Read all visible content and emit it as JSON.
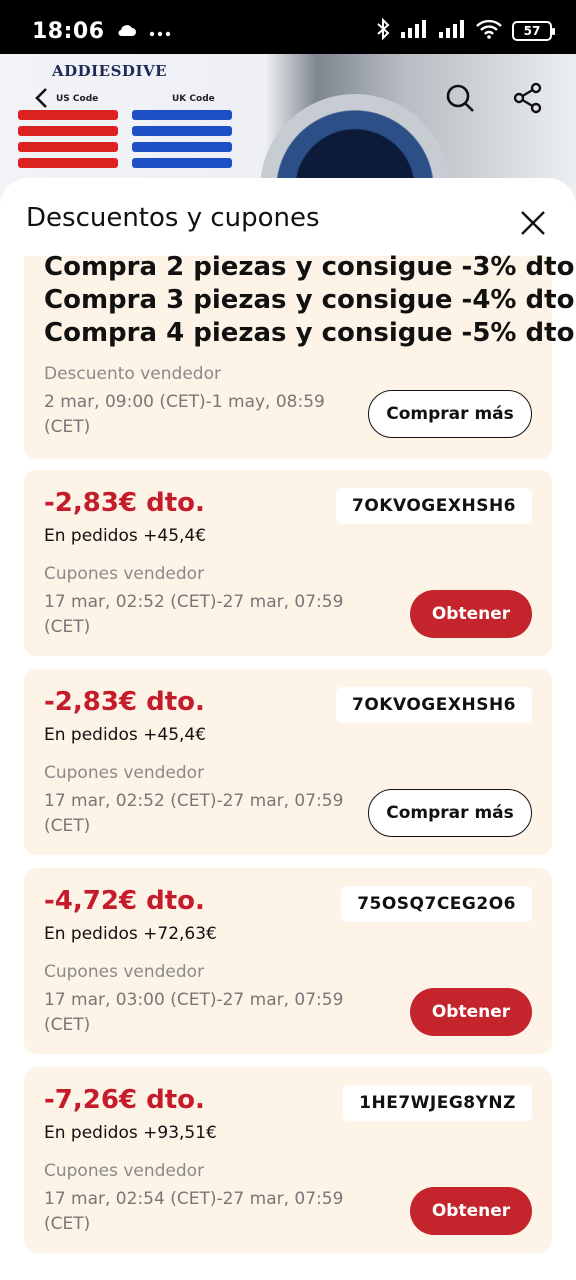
{
  "status_bar": {
    "time": "18:06",
    "battery": "57"
  },
  "hero": {
    "brand": "ADDIESDIVE",
    "us_code_label": "US Code",
    "uk_code_label": "UK Code"
  },
  "sheet": {
    "title": "Descuentos y cupones"
  },
  "promo_card": {
    "lines": [
      "Compra 2 piezas y consigue -3% dto.",
      "Compra 3 piezas y consigue -4% dto.",
      "Compra 4 piezas y consigue -5% dto."
    ],
    "label": "Descuento vendedor",
    "date": "2 mar, 09:00 (CET)-1 may, 08:59 (CET)",
    "button": "Comprar más"
  },
  "coupons": [
    {
      "discount": "-2,83€ dto.",
      "condition": "En pedidos +45,4€",
      "code": "7OKVOGEXHSH6",
      "label": "Cupones vendedor",
      "date": "17 mar, 02:52 (CET)-27 mar, 07:59 (CET)",
      "button": "Obtener"
    },
    {
      "discount": "-2,83€ dto.",
      "condition": "En pedidos +45,4€",
      "code": "7OKVOGEXHSH6",
      "label": "Cupones vendedor",
      "date": "17 mar, 02:52 (CET)-27 mar, 07:59 (CET)",
      "button": "Comprar más"
    },
    {
      "discount": "-4,72€ dto.",
      "condition": "En pedidos +72,63€",
      "code": "75OSQ7CEG2O6",
      "label": "Cupones vendedor",
      "date": "17 mar, 03:00 (CET)-27 mar, 07:59 (CET)",
      "button": "Obtener"
    },
    {
      "discount": "-7,26€ dto.",
      "condition": "En pedidos +93,51€",
      "code": "1HE7WJEG8YNZ",
      "label": "Cupones vendedor",
      "date": "17 mar, 02:54 (CET)-27 mar, 07:59 (CET)",
      "button": "Obtener"
    }
  ],
  "colors": {
    "accent_red": "#c4242b",
    "discount_red": "#c51c2c",
    "card_bg": "#fdf3e7"
  },
  "icons": {
    "back": "back-arrow-icon",
    "search": "search-icon",
    "share": "share-icon",
    "close": "close-icon"
  }
}
